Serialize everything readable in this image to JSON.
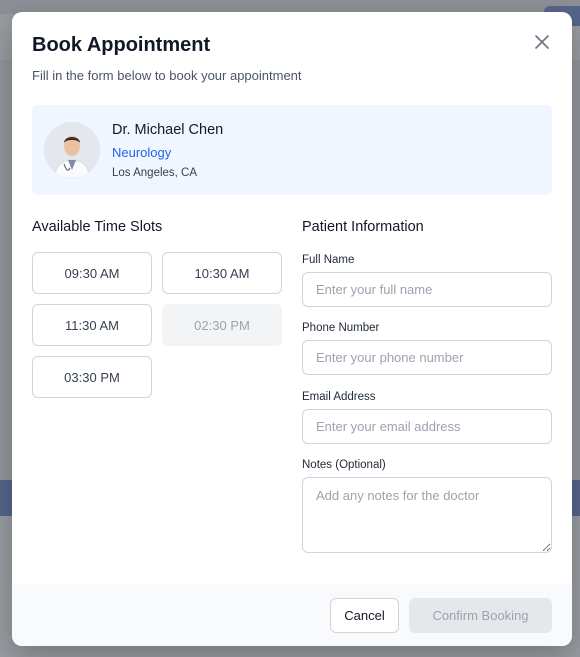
{
  "modal": {
    "title": "Book Appointment",
    "subtitle": "Fill in the form below to book your appointment",
    "close_icon": "close-icon"
  },
  "doctor": {
    "name": "Dr. Michael Chen",
    "specialty": "Neurology",
    "location": "Los Angeles, CA",
    "specialty_color": "#2563eb"
  },
  "time_slots": {
    "title": "Available Time Slots",
    "slots": [
      {
        "label": "09:30 AM",
        "available": true
      },
      {
        "label": "10:30 AM",
        "available": true
      },
      {
        "label": "11:30 AM",
        "available": true
      },
      {
        "label": "02:30 PM",
        "available": false
      },
      {
        "label": "03:30 PM",
        "available": true
      }
    ]
  },
  "patient": {
    "title": "Patient Information",
    "full_name": {
      "label": "Full Name",
      "placeholder": "Enter your full name",
      "value": ""
    },
    "phone": {
      "label": "Phone Number",
      "placeholder": "Enter your phone number",
      "value": ""
    },
    "email": {
      "label": "Email Address",
      "placeholder": "Enter your email address",
      "value": ""
    },
    "notes": {
      "label": "Notes (Optional)",
      "placeholder": "Add any notes for the doctor",
      "value": ""
    }
  },
  "footer": {
    "cancel_label": "Cancel",
    "confirm_label": "Confirm Booking"
  }
}
